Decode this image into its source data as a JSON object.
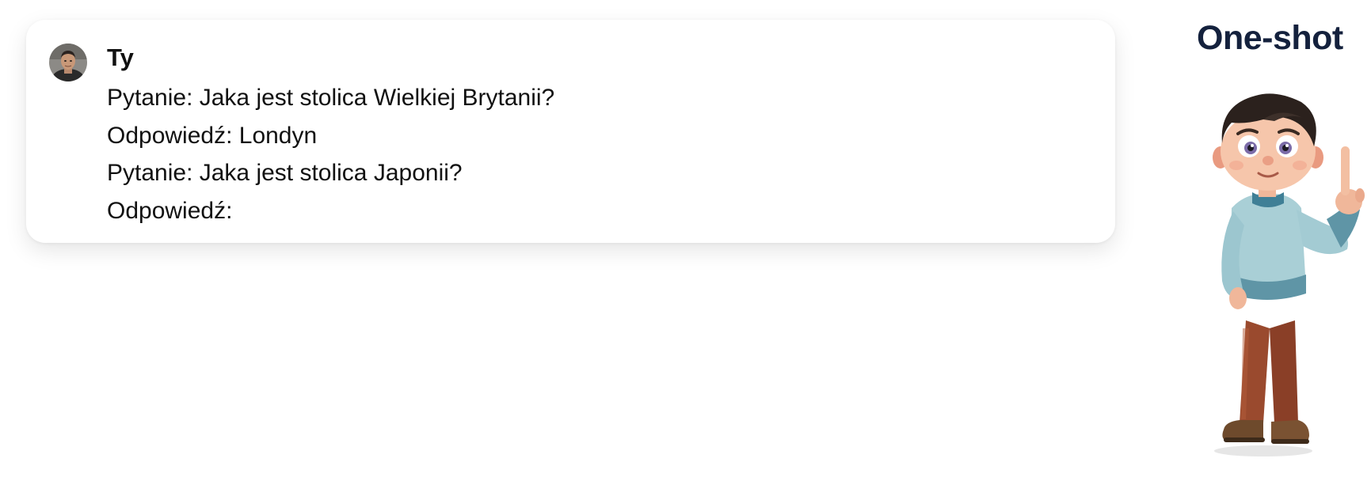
{
  "slide": {
    "heading": "One-shot"
  },
  "chat": {
    "author": "Ty",
    "lines": [
      "Pytanie: Jaka jest stolica Wielkiej Brytanii?",
      "Odpowiedź: Londyn",
      "Pytanie: Jaka jest stolica Japonii?",
      "Odpowiedź:"
    ],
    "avatar_icon": "user-avatar-photo"
  },
  "mascot": {
    "icon": "cartoon-boy-pointing-up"
  },
  "colors": {
    "heading": "#14213d",
    "text": "#111111",
    "card_background": "#ffffff",
    "sweater": "#a9cfd6",
    "trousers": "#9a4a2e"
  }
}
